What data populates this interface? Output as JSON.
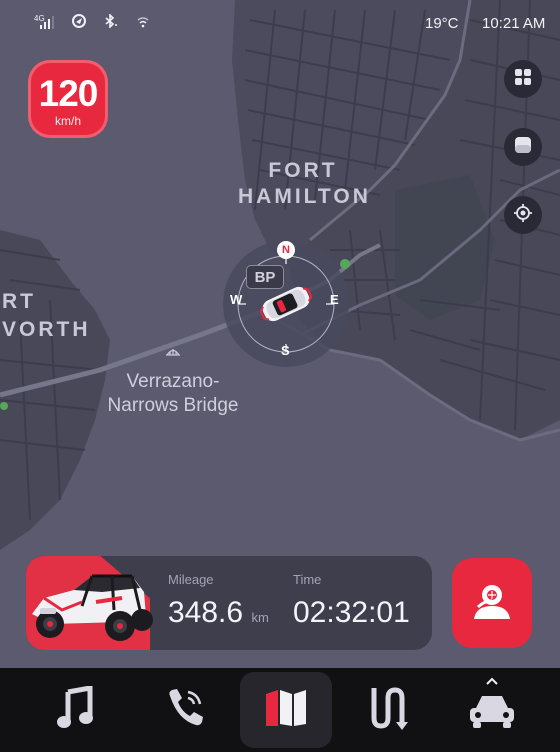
{
  "status_bar": {
    "network_label": "4G",
    "icons": [
      "signal-icon",
      "location-icon",
      "bluetooth-icon",
      "wifi-icon"
    ],
    "temperature": "19°C",
    "time": "10:21 AM"
  },
  "speed": {
    "value": "120",
    "unit": "km/h"
  },
  "map": {
    "labels": {
      "fort_hamilton": [
        "FORT",
        "HAMILTON"
      ],
      "fort_worth": [
        "RT",
        "VORTH"
      ],
      "bridge": [
        "Verrazano-",
        "Narrows Bridge"
      ],
      "bp_station": "BP"
    },
    "compass": {
      "north": "N",
      "south": "S",
      "east": "E",
      "west": "W"
    }
  },
  "map_controls": [
    "layers-icon",
    "map-style-icon",
    "recenter-icon"
  ],
  "trip": {
    "mileage_label": "Mileage",
    "mileage_value": "348.6",
    "mileage_unit": "km",
    "time_label": "Time",
    "time_value": "02:32:01"
  },
  "dock": {
    "items": [
      "music-icon",
      "phone-icon",
      "map-icon",
      "route-icon",
      "car-icon"
    ],
    "active": "map-icon",
    "expand_indicator": "chevron-up-icon"
  },
  "colors": {
    "accent": "#e8283e",
    "map_background": "#5b5a6e",
    "dock_background": "#111114",
    "card_background": "#3f3e4d"
  }
}
